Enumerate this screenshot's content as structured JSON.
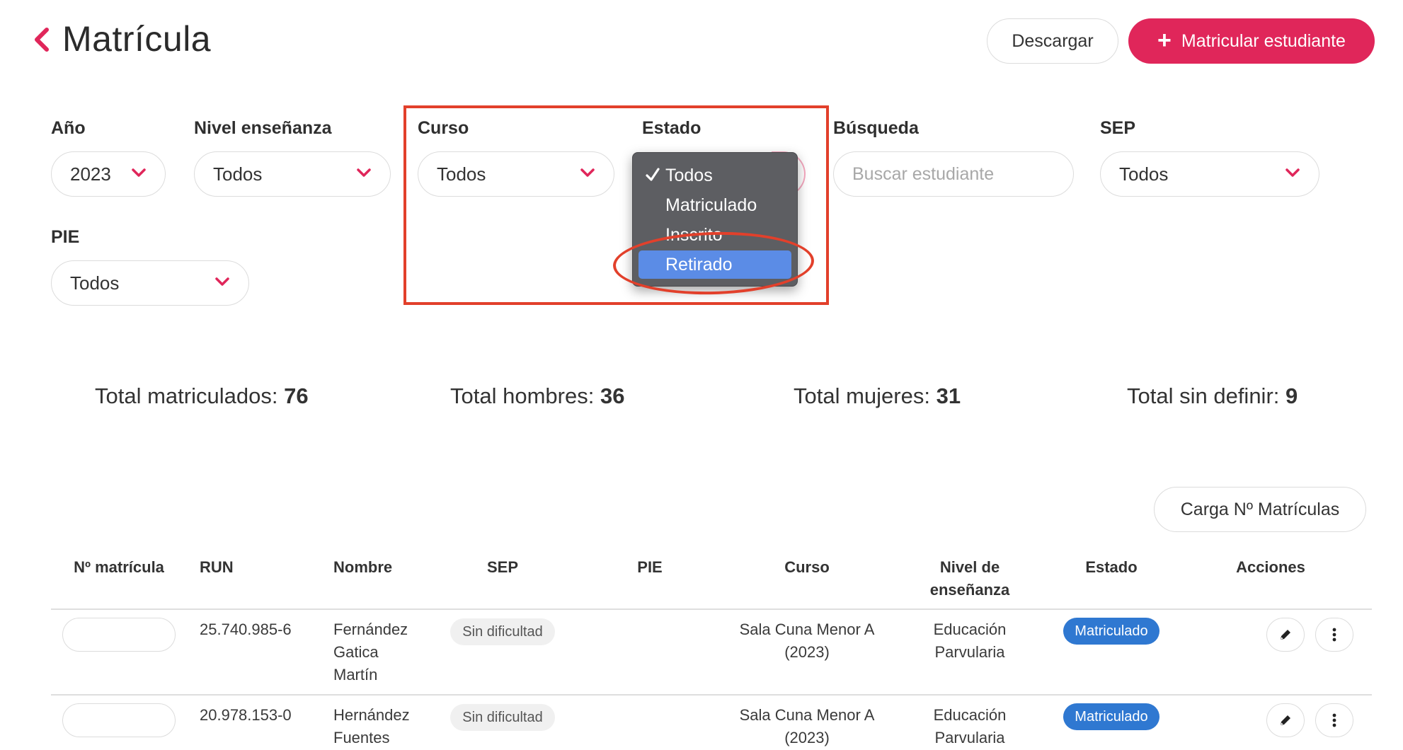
{
  "header": {
    "title": "Matrícula",
    "download_label": "Descargar",
    "enroll_label": "Matricular estudiante"
  },
  "filters": {
    "year": {
      "label": "Año",
      "value": "2023"
    },
    "level": {
      "label": "Nivel enseñanza",
      "value": "Todos"
    },
    "course": {
      "label": "Curso",
      "value": "Todos"
    },
    "status": {
      "label": "Estado",
      "options": [
        "Todos",
        "Matriculado",
        "Inscrito",
        "Retirado"
      ],
      "selected": "Todos",
      "hovered": "Retirado"
    },
    "search": {
      "label": "Búsqueda",
      "placeholder": "Buscar estudiante"
    },
    "sep": {
      "label": "SEP",
      "value": "Todos"
    },
    "pie": {
      "label": "PIE",
      "value": "Todos"
    }
  },
  "totals": {
    "enrolled": {
      "label": "Total matriculados:",
      "value": "76"
    },
    "men": {
      "label": "Total hombres:",
      "value": "36"
    },
    "women": {
      "label": "Total mujeres:",
      "value": "31"
    },
    "undefined": {
      "label": "Total sin definir:",
      "value": "9"
    }
  },
  "bulk_load_label": "Carga Nº Matrículas",
  "table": {
    "headers": {
      "number": "Nº matrícula",
      "run": "RUN",
      "name": "Nombre",
      "sep": "SEP",
      "pie": "PIE",
      "course": "Curso",
      "level_1": "Nivel de",
      "level_2": "enseñanza",
      "status": "Estado",
      "actions": "Acciones"
    },
    "rows": [
      {
        "run": "25.740.985-6",
        "name": [
          "Fernández",
          "Gatica",
          "Martín"
        ],
        "sep": "Sin dificultad",
        "course": [
          "Sala Cuna Menor A",
          "(2023)"
        ],
        "level": [
          "Educación",
          "Parvularia"
        ],
        "status": "Matriculado"
      },
      {
        "run": "20.978.153-0",
        "name": [
          "Hernández",
          "Fuentes"
        ],
        "sep": "Sin dificultad",
        "course": [
          "Sala Cuna Menor A",
          "(2023)"
        ],
        "level": [
          "Educación",
          "Parvularia"
        ],
        "status": "Matriculado"
      }
    ]
  },
  "colors": {
    "accent": "#e0265a",
    "status_blue": "#2f78d1",
    "annotation_red": "#e2402b",
    "dropdown_bg": "#5d5e62",
    "dropdown_highlight": "#5b8ce6"
  },
  "icons": {
    "back": "chevron-left-icon",
    "chevron": "chevron-down-icon",
    "check": "checkmark-icon",
    "edit": "pencil-icon",
    "more": "more-vertical-icon"
  }
}
